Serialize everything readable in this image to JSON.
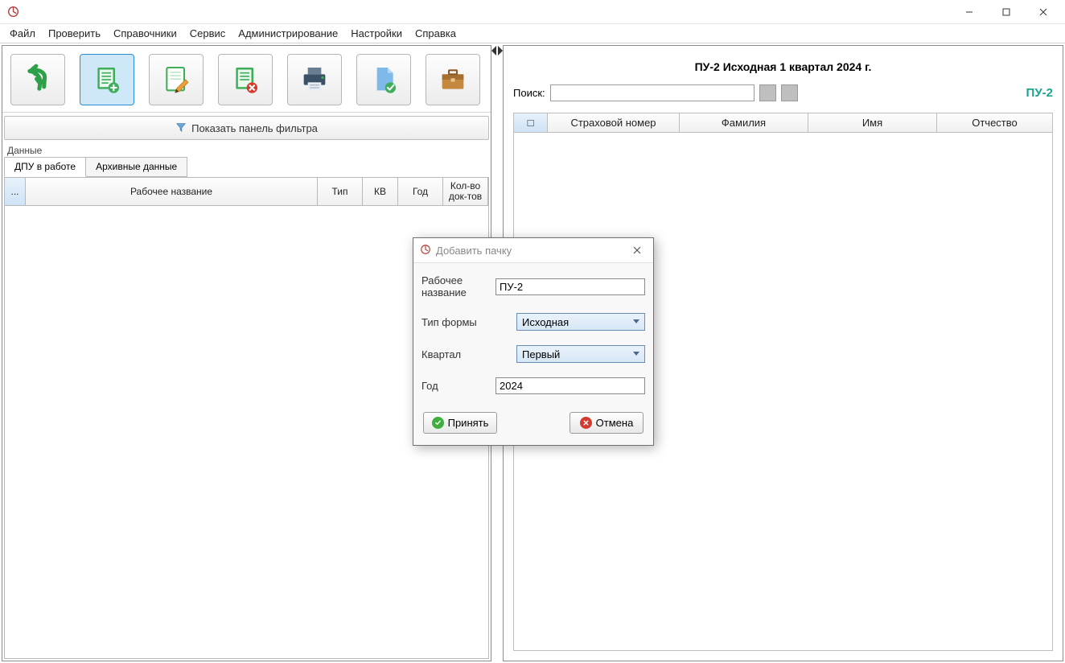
{
  "menu": {
    "file": "Файл",
    "check": "Проверить",
    "dicts": "Справочники",
    "service": "Сервис",
    "admin": "Администрирование",
    "settings": "Настройки",
    "help": "Справка"
  },
  "leftPane": {
    "filterBar": "Показать панель фильтра",
    "dataLegend": "Данные",
    "tabs": {
      "active": "ДПУ в работе",
      "archive": "Архивные данные"
    },
    "columns": {
      "selector": "...",
      "name": "Рабочее название",
      "type": "Тип",
      "kv": "КВ",
      "year": "Год",
      "count": "Кол-во\nдок-тов"
    }
  },
  "rightPane": {
    "title": "ПУ-2 Исходная 1 квартал 2024 г.",
    "searchLabel": "Поиск:",
    "puLabel": "ПУ-2",
    "columns": {
      "chk": "□",
      "num": "Страховой номер",
      "fam": "Фамилия",
      "im": "Имя",
      "ot": "Отчество"
    }
  },
  "modal": {
    "title": "Добавить пачку",
    "labels": {
      "name": "Рабочее название",
      "formType": "Тип формы",
      "quarter": "Квартал",
      "year": "Год"
    },
    "values": {
      "name": "ПУ-2",
      "formType": "Исходная",
      "quarter": "Первый",
      "year": "2024"
    },
    "buttons": {
      "accept": "Принять",
      "cancel": "Отмена"
    }
  }
}
